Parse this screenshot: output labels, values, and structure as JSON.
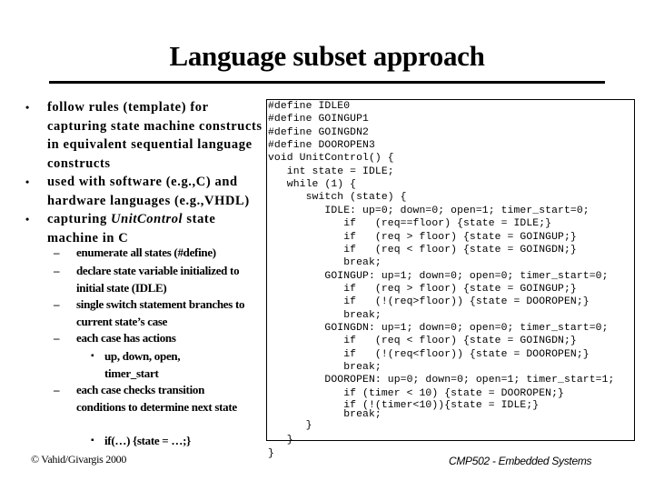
{
  "slide": {
    "title": "Language subset approach",
    "bullets": [
      {
        "text": "follow rules (template) for capturing state machine constructs in equivalent sequential language constructs"
      },
      {
        "text": "used with software (e.g.,C) and hardware languages (e.g.,VHDL)"
      },
      {
        "text_before": "capturing ",
        "text_italic": "UnitControl",
        "text_after": " state machine in C"
      }
    ],
    "sub_bullets": [
      {
        "text": "enumerate all states (#define)"
      },
      {
        "text": "declare state variable initialized to initial state (IDLE)"
      },
      {
        "text": "single switch statement branches to current state’s case"
      },
      {
        "text": "each case has actions"
      },
      {
        "text": "each case checks transition conditions to determine next state"
      }
    ],
    "sub_sub_bullets": [
      {
        "text": "up, down, open, timer_start"
      },
      {
        "text": "if(…) {state = …;}"
      }
    ],
    "bullet_glyph": "•",
    "dash_glyph": "–",
    "small_bullet_glyph": "▪",
    "code_lines": [
      "#define IDLE0",
      "#define GOINGUP1",
      "#define GOINGDN2",
      "#define DOOROPEN3",
      "void UnitControl() {",
      "   int state = IDLE;",
      "   while (1) {",
      "      switch (state) {",
      "         IDLE: up=0; down=0; open=1; timer_start=0;",
      "            if   (req==floor) {state = IDLE;}",
      "            if   (req > floor) {state = GOINGUP;}",
      "            if   (req < floor) {state = GOINGDN;}",
      "            break;",
      "         GOINGUP: up=1; down=0; open=0; timer_start=0;",
      "            if   (req > floor) {state = GOINGUP;}",
      "            if   (!(req>floor)) {state = DOOROPEN;}",
      "            break;",
      "         GOINGDN: up=1; down=0; open=0; timer_start=0;",
      "            if   (req < floor) {state = GOINGDN;}",
      "            if   (!(req<floor)) {state = DOOROPEN;}",
      "            break;",
      "         DOOROPEN: up=0; down=0; open=1; timer_start=1;",
      "            if (timer < 10) {state = DOOROPEN;}",
      "            if (!(timer<10)){state = IDLE;}",
      "            break;",
      "      }",
      "   }",
      "}"
    ],
    "footer_left": "© Vahid/Givargis 2000",
    "footer_right": "CMP502 - Embedded Systems"
  }
}
